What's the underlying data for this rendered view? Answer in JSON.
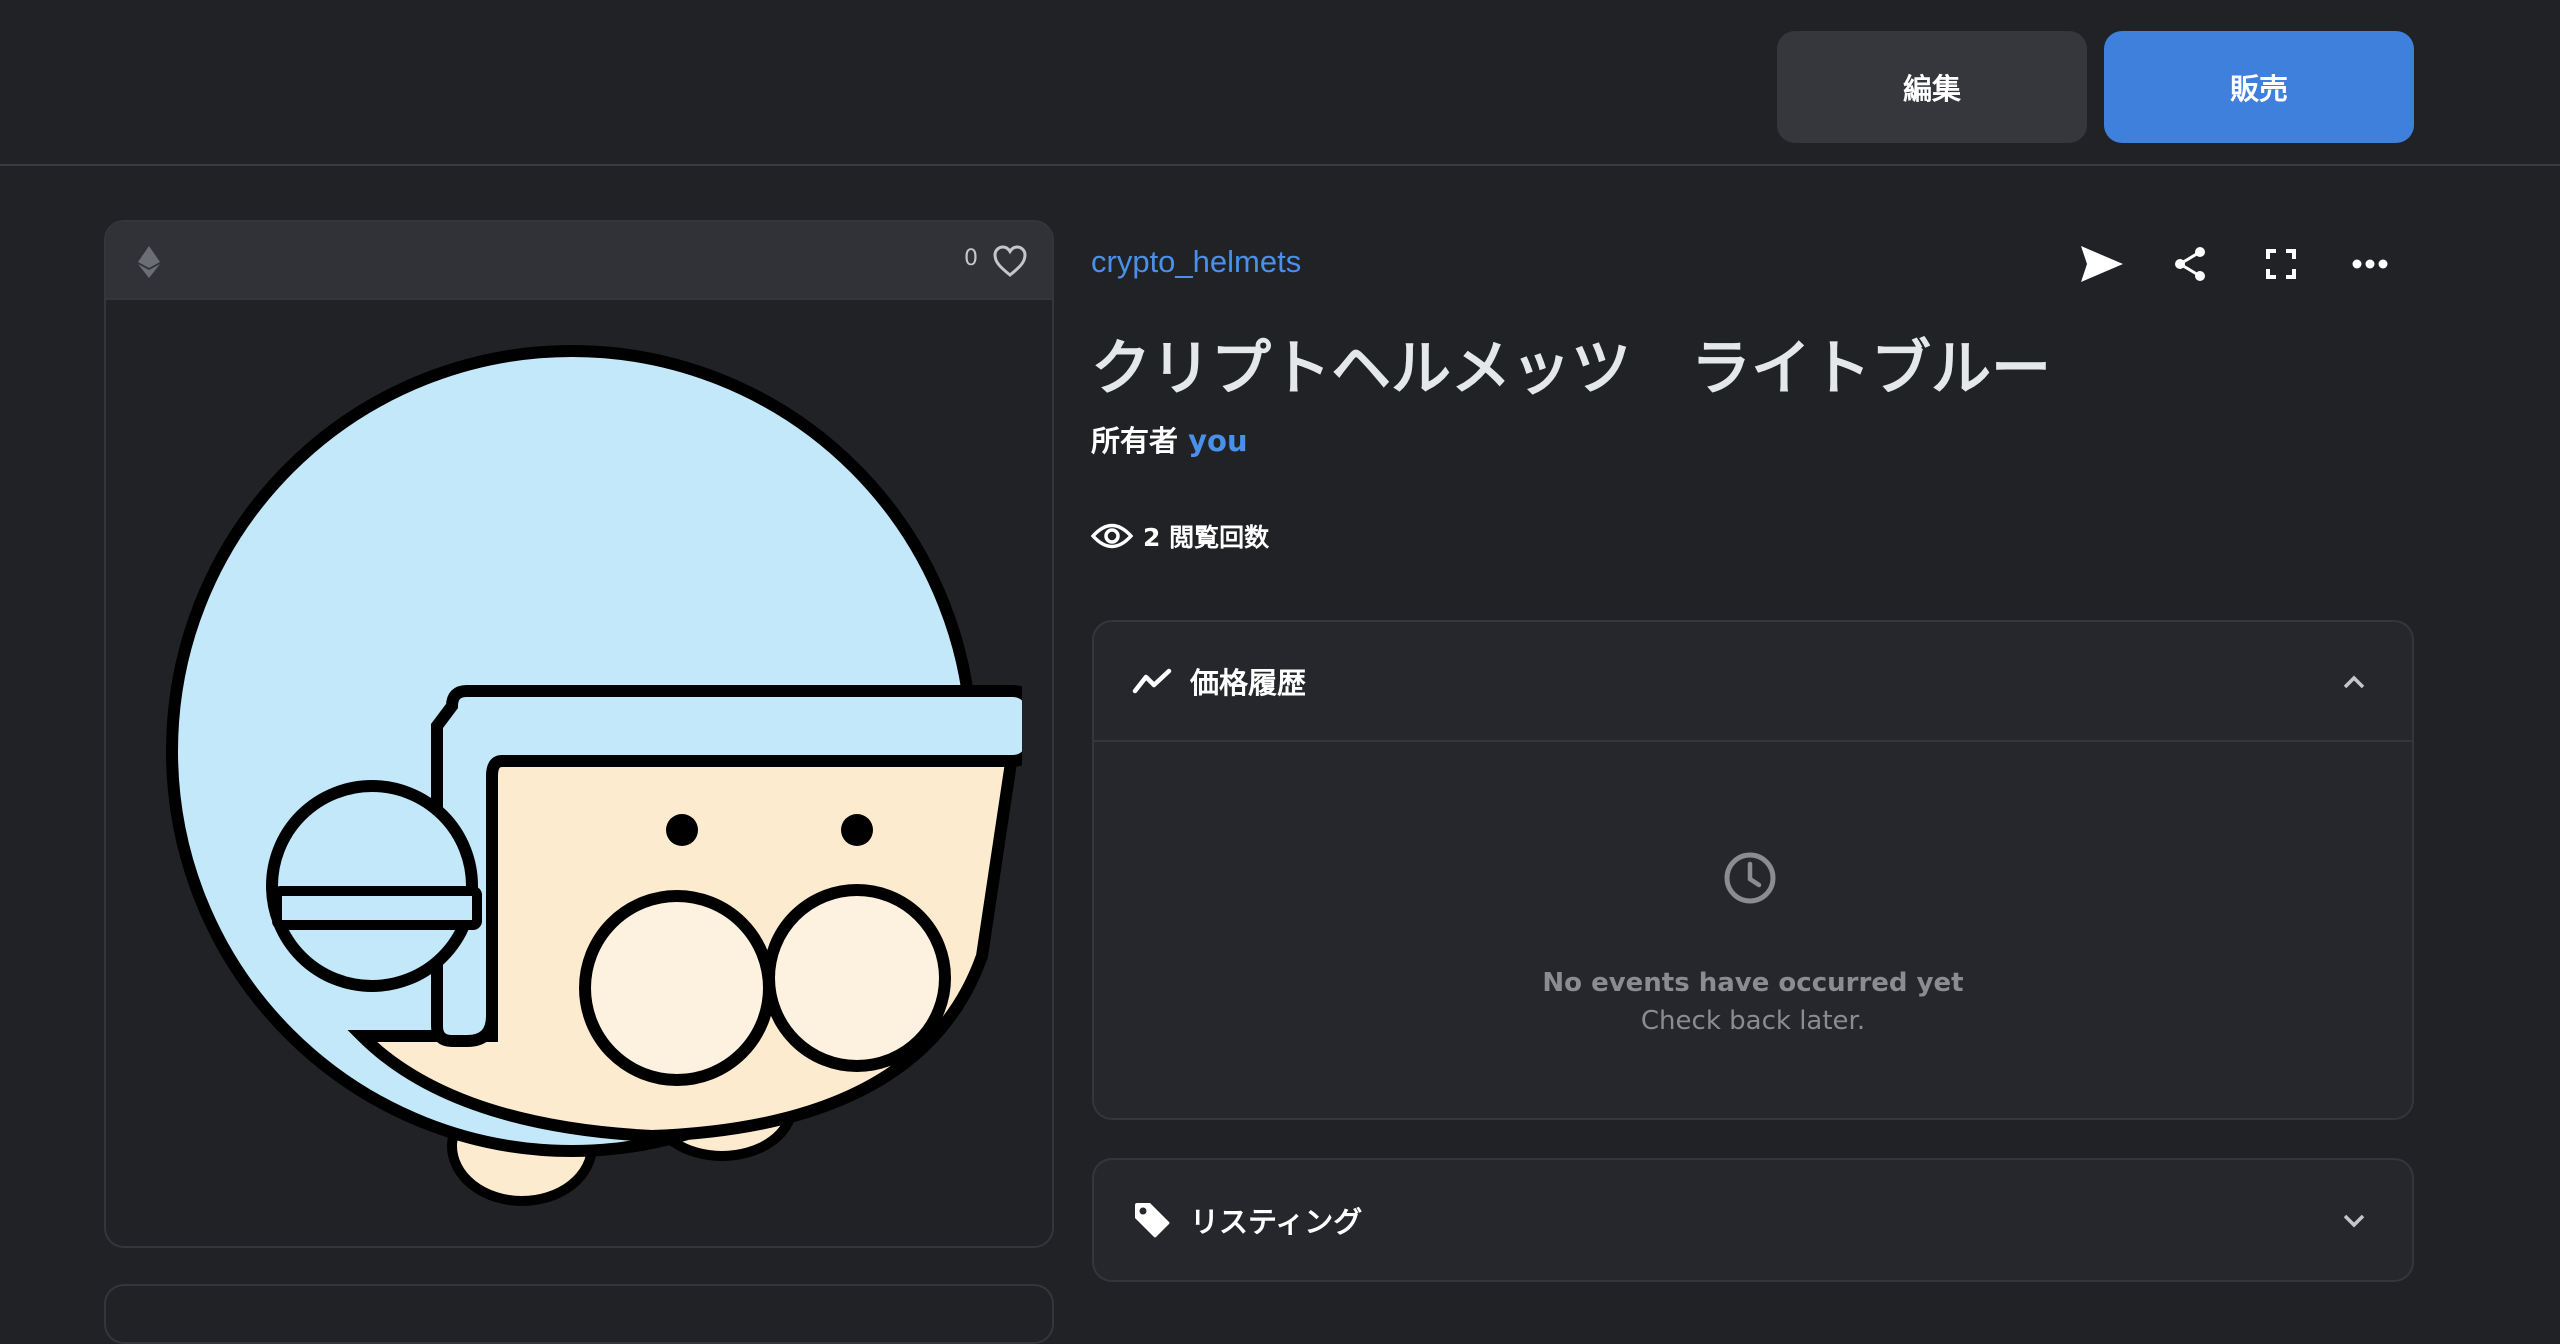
{
  "toolbar": {
    "edit_label": "編集",
    "sell_label": "販売"
  },
  "media": {
    "chain_icon": "ethereum-icon",
    "favorites_count": "0",
    "favorite_icon": "heart-icon"
  },
  "item": {
    "collection": "crypto_helmets",
    "title": "クリプトヘルメッツ　ライトブルー",
    "owner_prefix": "所有者",
    "owner_name": "you",
    "views_text": "2 閲覧回数"
  },
  "actions": {
    "icons": [
      "send-icon",
      "share-icon",
      "fullscreen-icon",
      "more-icon"
    ]
  },
  "price_history": {
    "title": "価格履歴",
    "icon": "trend-line-icon",
    "expanded": true,
    "empty_title": "No events have occurred yet",
    "empty_subtitle": "Check back later."
  },
  "listings": {
    "title": "リスティング",
    "icon": "tag-icon",
    "expanded": false
  },
  "colors": {
    "background": "#202225",
    "accent": "#3e80dc",
    "link": "#4a8fe8",
    "helmet": "#c3e8fa",
    "face": "#fdebd0"
  }
}
